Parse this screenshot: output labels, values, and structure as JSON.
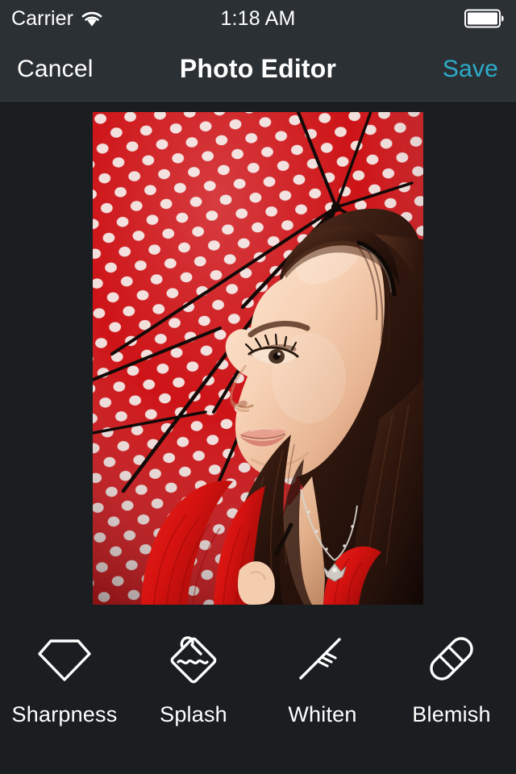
{
  "status_bar": {
    "carrier": "Carrier",
    "wifi_icon": "wifi-icon",
    "time": "1:18 AM",
    "battery_icon": "battery-full-icon"
  },
  "nav_bar": {
    "cancel_label": "Cancel",
    "title": "Photo Editor",
    "save_label": "Save",
    "save_color": "#2dacca"
  },
  "photo": {
    "alt": "Young woman with long dark hair in a red sweater looking upward beneath a red polka-dot umbrella",
    "background_color": "#1b1e20",
    "umbrella_color": "#cc0c10",
    "dot_color": "#f0dcd8"
  },
  "toolbar": {
    "tools": [
      {
        "label": "Sharpness",
        "icon": "diamond-gem-icon"
      },
      {
        "label": "Splash",
        "icon": "water-splash-tag-icon"
      },
      {
        "label": "Whiten",
        "icon": "toothbrush-icon"
      },
      {
        "label": "Blemish",
        "icon": "bandage-icon"
      }
    ]
  },
  "theme": {
    "bar_background": "#2b3034",
    "content_background": "#1b1e20",
    "text_color": "#ffffff",
    "accent_color": "#2dacca"
  }
}
